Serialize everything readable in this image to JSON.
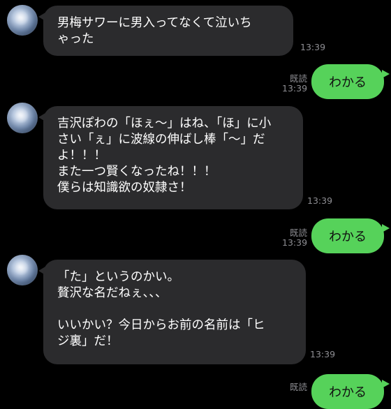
{
  "colors": {
    "background": "#000000",
    "incoming_bubble": "#2b2b2d",
    "outgoing_bubble": "#56d25a",
    "meta_text": "#8e8e93"
  },
  "messages": [
    {
      "sender": "other",
      "avatar": "avatar-icon",
      "text": "男梅サワーに男入ってなくて泣いち\nゃった",
      "time": "13:39"
    },
    {
      "sender": "me",
      "text": "わかる",
      "read": "既読",
      "time": "13:39"
    },
    {
      "sender": "other",
      "avatar": "avatar-icon",
      "text": "吉沢ぽわの「ほぇ〜」はね、「ほ」に小\nさい「ぇ」に波線の伸ばし棒「〜」だ\nよ！！！\nまた一つ賢くなったね！！！\n僕らは知識欲の奴隷さ！",
      "time": "13:39"
    },
    {
      "sender": "me",
      "text": "わかる",
      "read": "既読",
      "time": "13:39"
    },
    {
      "sender": "other",
      "avatar": "avatar-icon",
      "text": "「た」というのかい。\n贅沢な名だねぇ、、、\n\nいいかい？今日からお前の名前は「ヒ\nジ裏」だ！",
      "time": "13:39"
    },
    {
      "sender": "me",
      "text": "わかる",
      "read": "既読",
      "time": ""
    }
  ]
}
